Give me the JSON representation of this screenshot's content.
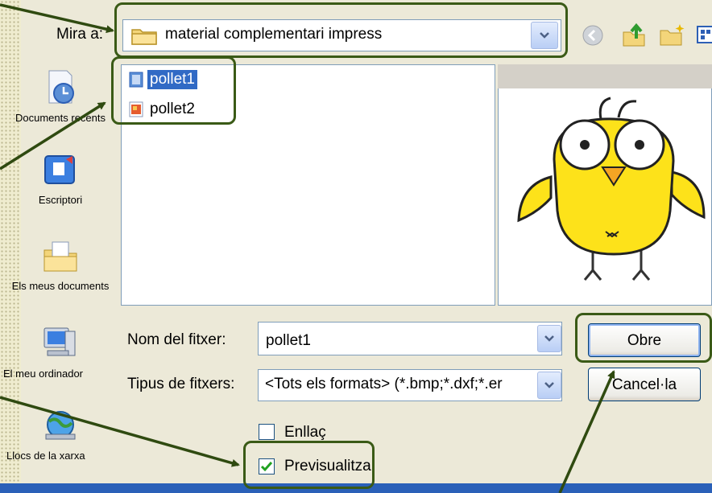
{
  "dialog": {
    "look_in_label": "Mira a:",
    "look_in_value": "material complementari impress",
    "toolbar": {
      "back_icon": "back-arrow-icon",
      "up_icon": "up-folder-icon",
      "new_folder_icon": "new-folder-icon",
      "views_icon": "views-menu-icon"
    },
    "places": [
      {
        "label": "Documents recents",
        "icon": "recent-documents-icon"
      },
      {
        "label": "Escriptori",
        "icon": "desktop-icon"
      },
      {
        "label": "Els meus documents",
        "icon": "my-documents-icon"
      },
      {
        "label": "El meu ordinador",
        "icon": "my-computer-icon"
      },
      {
        "label": "Llocs de la xarxa",
        "icon": "network-places-icon"
      }
    ],
    "files": [
      {
        "name": "pollet1",
        "selected": true
      },
      {
        "name": "pollet2",
        "selected": false
      }
    ],
    "file_name_label": "Nom del fitxer:",
    "file_name_value": "pollet1",
    "file_type_label": "Tipus de fitxers:",
    "file_type_value": "<Tots els formats> (*.bmp;*.dxf;*.er",
    "open_button": "Obre",
    "cancel_button": "Cancel·la",
    "link_checkbox": {
      "label": "Enllaç",
      "checked": false
    },
    "preview_checkbox": {
      "label": "Previsualitza",
      "checked": true
    },
    "preview_image": "yellow-chick-cartoon"
  },
  "annotation_color": "#3a5a16"
}
